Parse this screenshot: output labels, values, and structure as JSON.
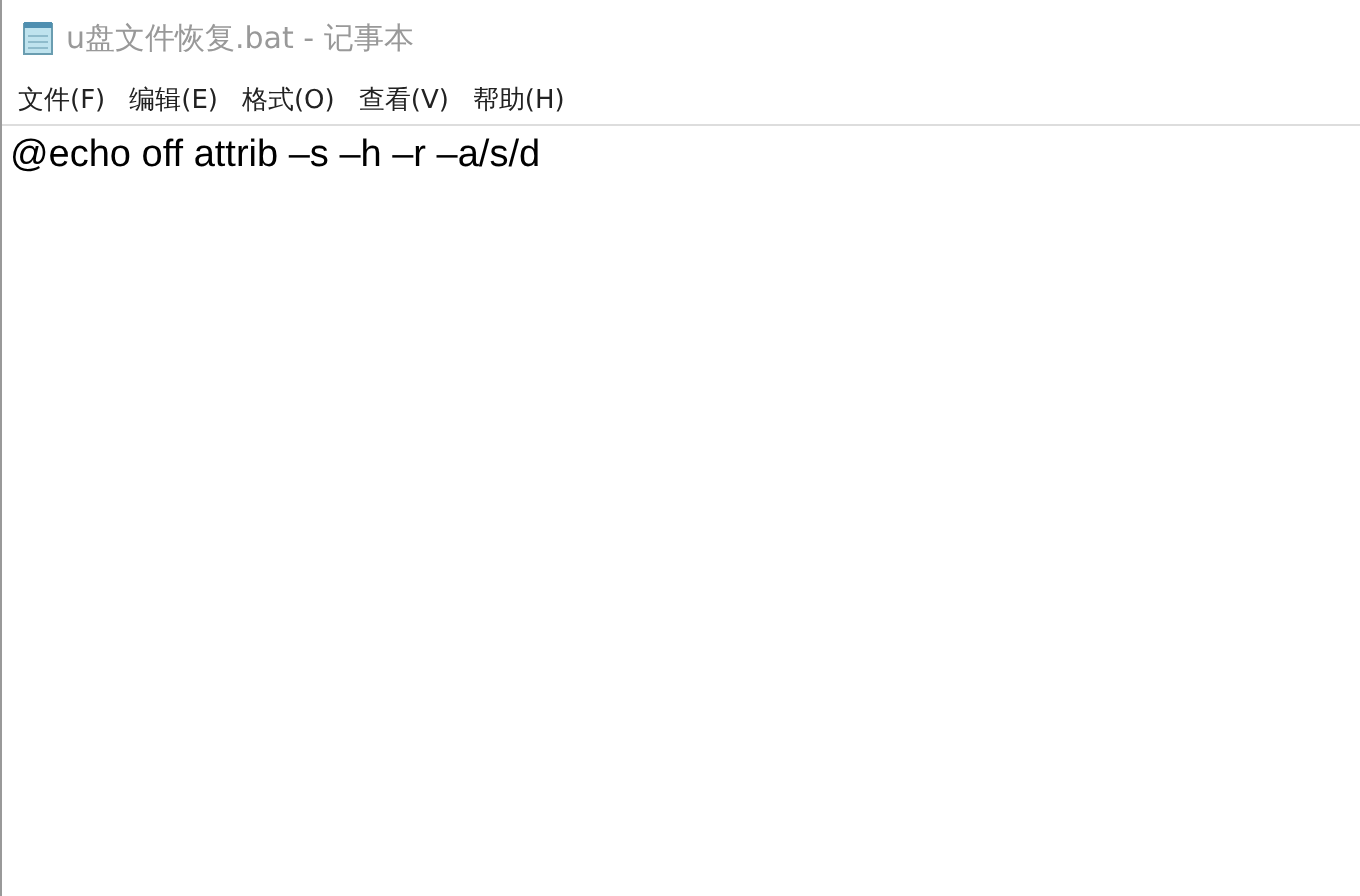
{
  "window": {
    "title": "u盘文件恢复.bat - 记事本"
  },
  "menu": [
    "文件(F)",
    "编辑(E)",
    "格式(O)",
    "查看(V)",
    "帮助(H)"
  ],
  "editor": {
    "text": "@echo off attrib –s –h –r –a/s/d"
  }
}
